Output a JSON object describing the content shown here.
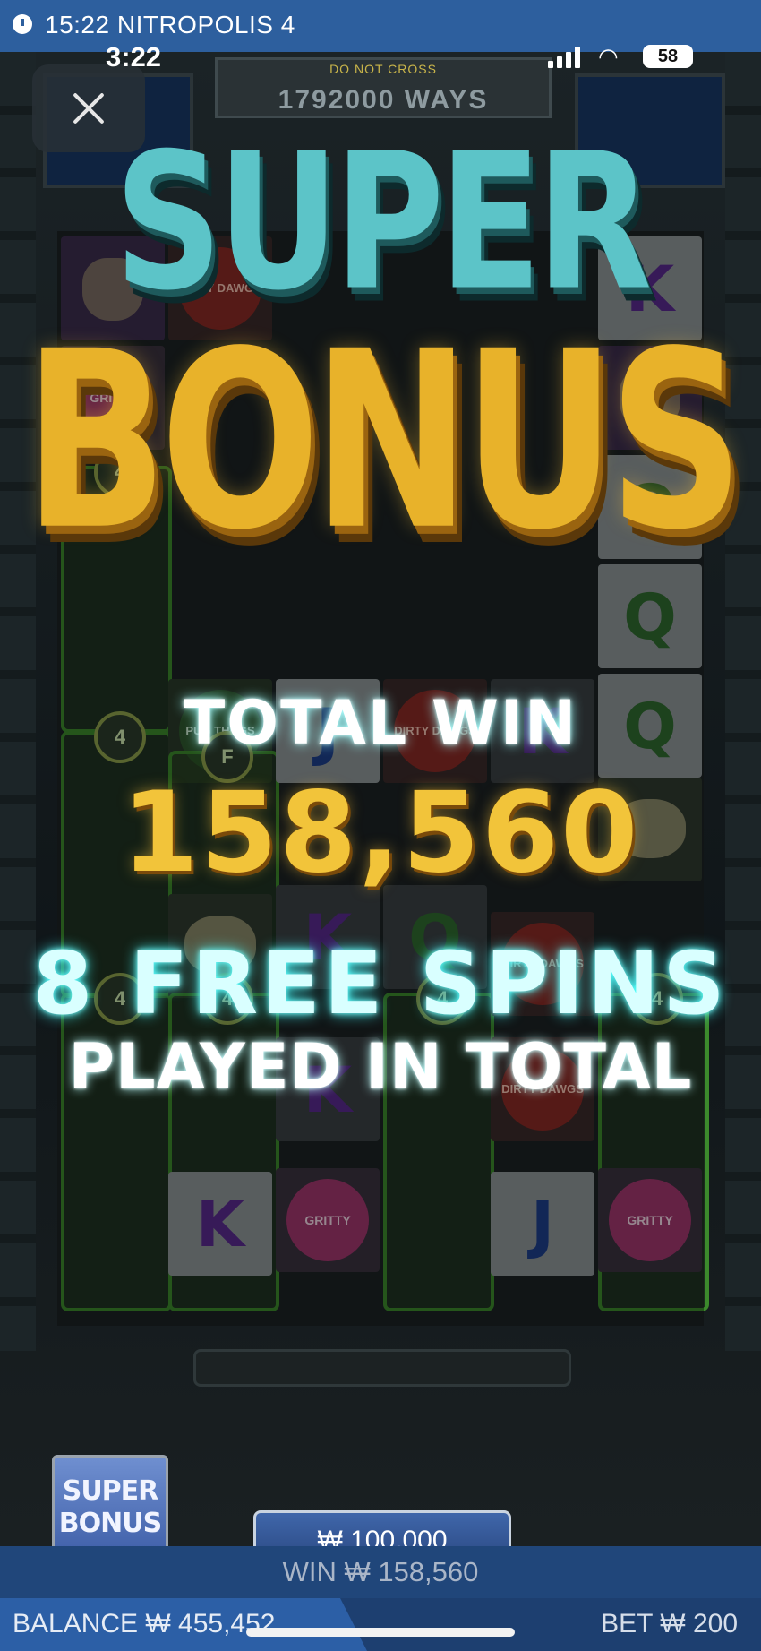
{
  "notification": {
    "title": "15:22 NITROPOLIS 4",
    "icon": "clock-icon"
  },
  "status_bar": {
    "time": "3:22",
    "battery": "58",
    "icons": [
      "signal-icon",
      "wifi-icon",
      "battery-icon"
    ]
  },
  "game": {
    "ways": "1792000 WAYS",
    "warning": "DO NOT CROSS",
    "logo": "NITROPOLIS 4",
    "overlay": {
      "line1": "SUPER",
      "line2": "BONUS",
      "total_win_label": "TOTAL WIN",
      "total_win_amount": "158,560",
      "free_spins": "8 FREE SPINS",
      "played": "PLAYED IN TOTAL"
    },
    "symbols": {
      "gritty_kitty": "GRITTY KITTY",
      "dirty_dawgs": "DIRTY DAWGS",
      "pug_thugs": "PUG THUGS",
      "multiplier": "4",
      "f": "F"
    }
  },
  "controls": {
    "super_bonus_line1": "SUPER",
    "super_bonus_line2": "BONUS",
    "buy_amount": "₩ 100,000"
  },
  "footer": {
    "win": "WIN ₩ 158,560",
    "balance": "BALANCE ₩ 455,452",
    "bet": "BET ₩ 200"
  },
  "colors": {
    "accent_blue": "#2d5f9e",
    "gold": "#e8b22a",
    "teal": "#5cc4c8"
  }
}
